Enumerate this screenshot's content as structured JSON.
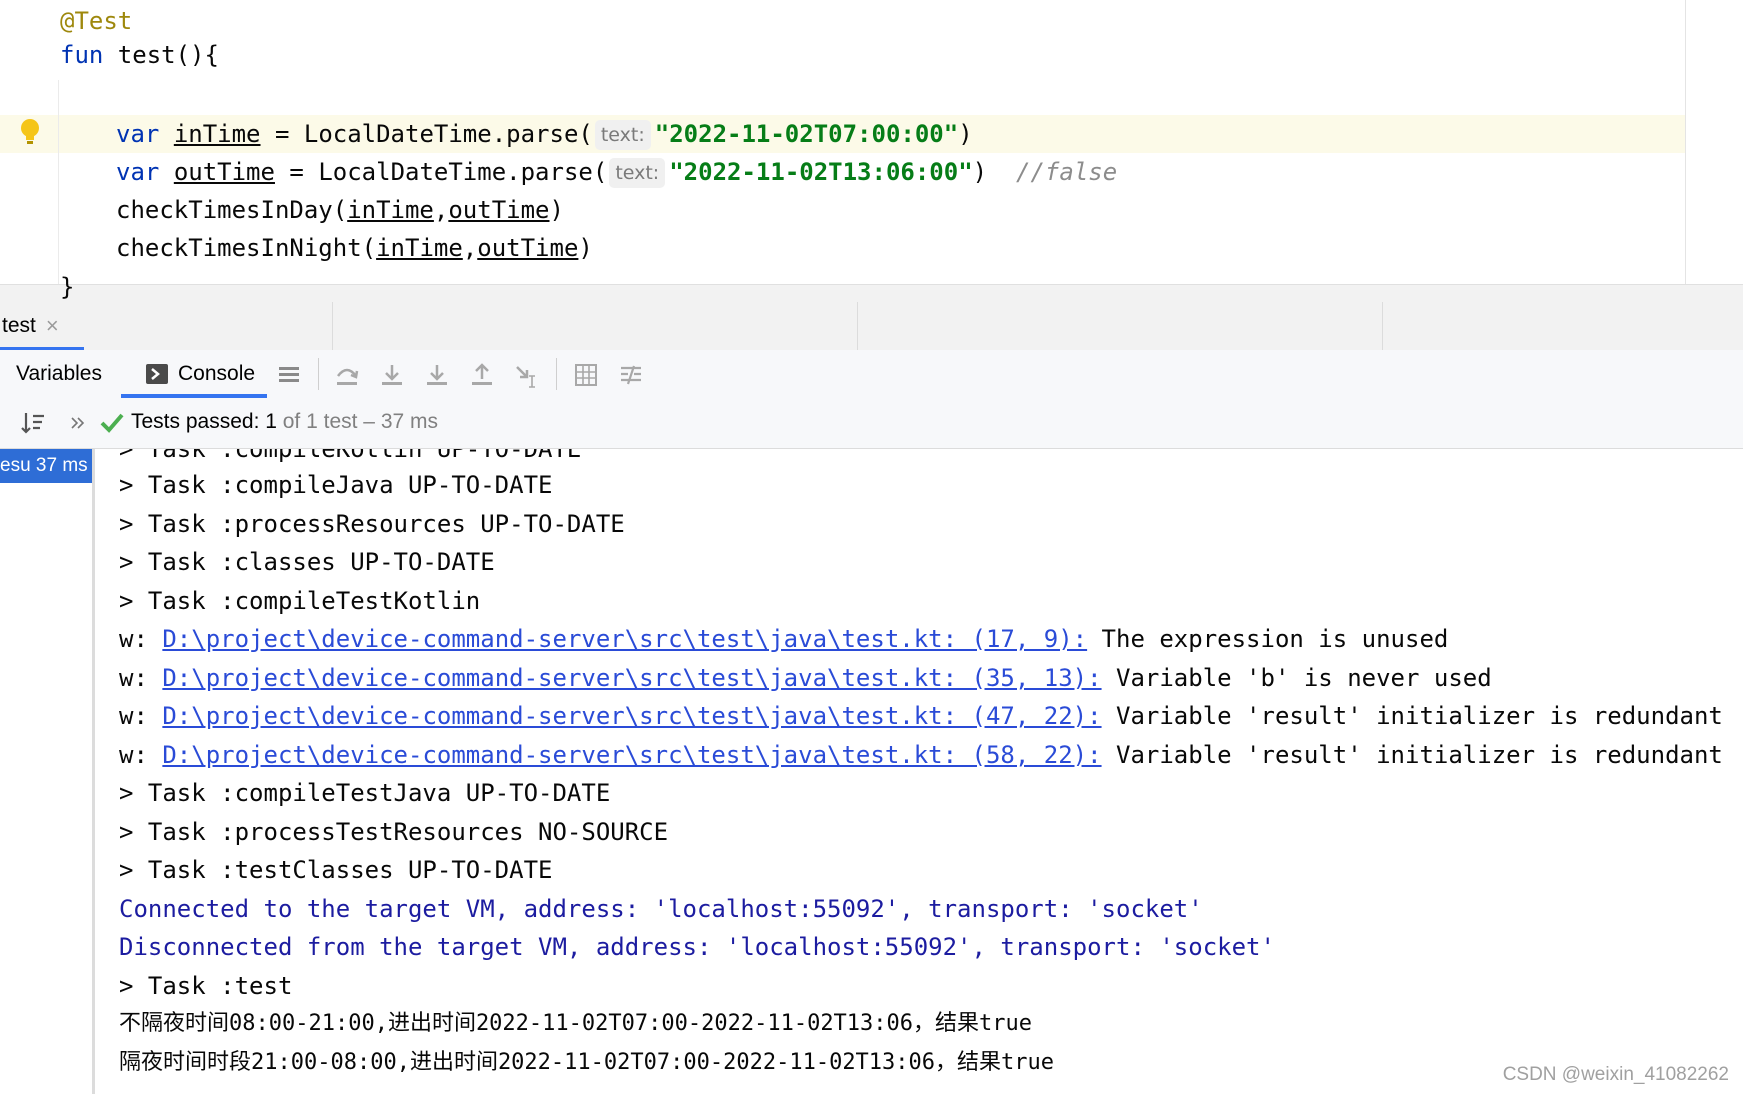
{
  "editor": {
    "lines": {
      "annotation": "@Test",
      "fun_kw": "fun",
      "fun_rest": " test(){",
      "l1_var": "var",
      "l1_name": "inTime",
      "l1_mid": " = LocalDateTime.parse(",
      "l1_hint": "text:",
      "l1_str": "\"2022-11-02T07:00:00\"",
      "l1_end": ")",
      "l2_var": "var",
      "l2_name": "outTime",
      "l2_mid": " = LocalDateTime.parse(",
      "l2_hint": "text:",
      "l2_str": "\"2022-11-02T13:06:00\"",
      "l2_end": ")  ",
      "l2_comment": "//false",
      "l3_fn": "checkTimesInDay(",
      "l3_a": "inTime",
      "l3_comma": ",",
      "l3_b": "outTime",
      "l3_end": ")",
      "l4_fn": "checkTimesInNight(",
      "l4_a": "inTime",
      "l4_comma": ",",
      "l4_b": "outTime",
      "l4_end": ")",
      "close": "}"
    }
  },
  "run_tab": {
    "label": "test",
    "close": "×"
  },
  "toolbar": {
    "variables": "Variables",
    "console": "Console"
  },
  "status": {
    "passed": "Tests passed: 1",
    "rest": " of 1 test – 37 ms"
  },
  "tree": {
    "item": "esu 37 ms"
  },
  "console": {
    "lines": [
      "> Task :compileKotlin UP-TO-DATE",
      "> Task :compileJava UP-TO-DATE",
      "> Task :processResources UP-TO-DATE",
      "> Task :classes UP-TO-DATE",
      "> Task :compileTestKotlin"
    ],
    "warnings": [
      {
        "prefix": "w: ",
        "link": "D:\\project\\device-command-server\\src\\test\\java\\test.kt: (17, 9):",
        "msg": " The expression is unused"
      },
      {
        "prefix": "w: ",
        "link": "D:\\project\\device-command-server\\src\\test\\java\\test.kt: (35, 13):",
        "msg": " Variable 'b' is never used"
      },
      {
        "prefix": "w: ",
        "link": "D:\\project\\device-command-server\\src\\test\\java\\test.kt: (47, 22):",
        "msg": " Variable 'result' initializer is redundant"
      },
      {
        "prefix": "w: ",
        "link": "D:\\project\\device-command-server\\src\\test\\java\\test.kt: (58, 22):",
        "msg": " Variable 'result' initializer is redundant"
      }
    ],
    "after": [
      "> Task :compileTestJava UP-TO-DATE",
      "> Task :processTestResources NO-SOURCE",
      "> Task :testClasses UP-TO-DATE"
    ],
    "connected": "Connected to the target VM, address: 'localhost:55092', transport: 'socket'",
    "disconnected": "Disconnected from the target VM, address: 'localhost:55092', transport: 'socket'",
    "task_test": "> Task :test",
    "result1": "不隔夜时间08:00-21:00,进出时间2022-11-02T07:00-2022-11-02T13:06，结果true",
    "result2": "隔夜时间时段21:00-08:00,进出时间2022-11-02T07:00-2022-11-02T13:06，结果true"
  },
  "watermark": "CSDN @weixin_41082262",
  "colors": {
    "accent": "#3574f0",
    "keyword": "#0033b3",
    "string": "#067d17",
    "link": "#2a4bd7",
    "success": "#4caf50"
  },
  "icons": [
    "lightbulb-icon",
    "console-icon",
    "list-icon",
    "step-over-icon",
    "step-into-icon",
    "force-step-into-icon",
    "step-out-icon",
    "run-to-cursor-icon",
    "evaluate-icon",
    "trace-icon",
    "sort-icon",
    "expand-icon",
    "check-icon",
    "close-icon"
  ]
}
